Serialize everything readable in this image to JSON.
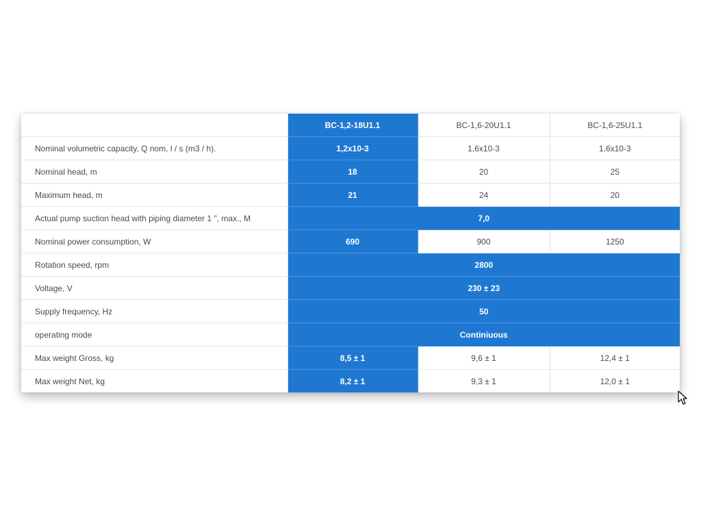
{
  "table": {
    "headers": [
      "",
      "BC-1,2-18U1.1",
      "BC-1,6-20U1.1",
      "BC-1,6-25U1.1"
    ],
    "rows": [
      {
        "label": "Nominal volumetric capacity, Q nom, l / s (m3 / h).",
        "values": [
          "1,2x10-3",
          "1,6x10-3",
          "1,6x10-3"
        ]
      },
      {
        "label": "Nominal head, m",
        "values": [
          "18",
          "20",
          "25"
        ]
      },
      {
        "label": "Maximum head, m",
        "values": [
          "21",
          "24",
          "20"
        ]
      },
      {
        "label": "Actual pump suction head with piping diameter 1 \", max., M",
        "merged": "7,0"
      },
      {
        "label": "Nominal power consumption, W",
        "values": [
          "690",
          "900",
          "1250"
        ]
      },
      {
        "label": "Rotation speed, rpm",
        "merged": "2800"
      },
      {
        "label": "Voltage, V",
        "merged": "230 ± 23"
      },
      {
        "label": "Supply frequency, Hz",
        "merged": "50"
      },
      {
        "label": "operating mode",
        "merged": "Continiuous"
      },
      {
        "label": "Max weight Gross, kg",
        "values": [
          "8,5 ± 1",
          "9,6 ± 1",
          "12,4 ± 1"
        ]
      },
      {
        "label": "Max weight Net, kg",
        "values": [
          "8,2 ± 1",
          "9,3 ± 1",
          "12,0 ± 1"
        ]
      }
    ]
  },
  "colors": {
    "highlight": "#1e78d2",
    "text": "#4a4a4a",
    "border": "#e3e3e3"
  },
  "cursor": {
    "icon": "mouse-pointer-icon"
  }
}
